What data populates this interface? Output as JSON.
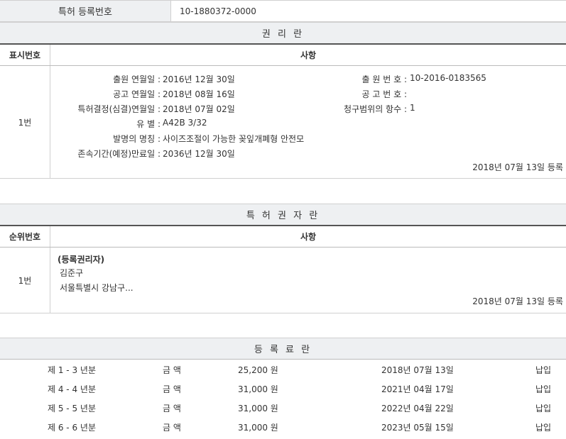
{
  "registration": {
    "label": "특허 등록번호",
    "value": "10-1880372-0000"
  },
  "rights_section": {
    "title": "권 리 란",
    "col_index": "표시번호",
    "col_matter": "사항",
    "row_no": "1번",
    "left_fields": [
      {
        "label": "출원 연월일 :",
        "value": "2016년 12월 30일"
      },
      {
        "label": "공고 연월일 :",
        "value": "2018년 08월 16일"
      },
      {
        "label": "특허결정(심결)연월일 :",
        "value": "2018년 07월 02일"
      },
      {
        "label": "유  별 :",
        "value": "A42B 3/32"
      },
      {
        "label": "발명의 명칭 :",
        "value": "사이즈조절이 가능한 꽂잎개폐형 안전모"
      },
      {
        "label": "존속기간(예정)만료일 :",
        "value": "2036년 12월 30일"
      }
    ],
    "right_fields": [
      {
        "label": "출 원 번 호 :",
        "value": "10-2016-0183565"
      },
      {
        "label": "공 고 번 호 :",
        "value": ""
      },
      {
        "label": "청구범위의 항수 :",
        "value": "1"
      }
    ],
    "reg_note": "2018년 07월 13일 등록"
  },
  "holder_section": {
    "title": "특 허 권 자 란",
    "col_index": "순위번호",
    "col_matter": "사항",
    "row_no": "1번",
    "holder_tag": "(등록권리자)",
    "holder_name": "김준구",
    "holder_address": "서울특별시 강남구...",
    "reg_note": "2018년 07월 13일 등록"
  },
  "fee_section": {
    "title": "등 록 료 란",
    "rows": [
      {
        "period": "제 1 - 3 년분",
        "amount_label": "금 액",
        "amount": "25,200 원",
        "date": "2018년 07월 13일",
        "status": "납입"
      },
      {
        "period": "제 4 - 4 년분",
        "amount_label": "금 액",
        "amount": "31,000 원",
        "date": "2021년 04월 17일",
        "status": "납입"
      },
      {
        "period": "제 5 - 5 년분",
        "amount_label": "금 액",
        "amount": "31,000 원",
        "date": "2022년 04월 22일",
        "status": "납입"
      },
      {
        "period": "제 6 - 6 년분",
        "amount_label": "금 액",
        "amount": "31,000 원",
        "date": "2023년 05월 15일",
        "status": "납입"
      }
    ]
  }
}
